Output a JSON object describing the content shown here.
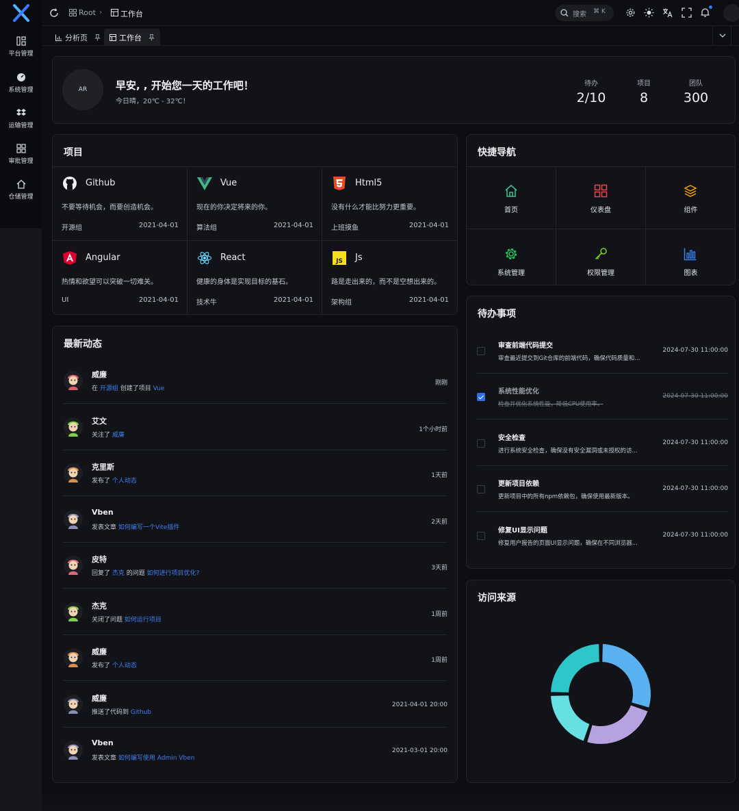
{
  "sidebar": {
    "items": [
      {
        "label": "平台管理",
        "icon": "platform-icon"
      },
      {
        "label": "系统管理",
        "icon": "dashboard-icon"
      },
      {
        "label": "运输管理",
        "icon": "dropbox-icon"
      },
      {
        "label": "审批管理",
        "icon": "grid-icon"
      },
      {
        "label": "仓储管理",
        "icon": "home-icon"
      }
    ]
  },
  "header": {
    "breadcrumb": [
      "Root",
      "工作台"
    ],
    "search_placeholder": "搜索",
    "search_shortcut": "⌘ K"
  },
  "tabs": [
    {
      "label": "分析页",
      "icon": "chart-icon",
      "active": false
    },
    {
      "label": "工作台",
      "icon": "workspace-icon",
      "active": true
    }
  ],
  "welcome": {
    "avatar_text": "AR",
    "greeting": "早安, , 开始您一天的工作吧！",
    "weather": "今日晴，20℃ - 32℃！",
    "stats": [
      {
        "label": "待办",
        "value": "2/10"
      },
      {
        "label": "项目",
        "value": "8"
      },
      {
        "label": "团队",
        "value": "300"
      }
    ]
  },
  "projects": {
    "title": "项目",
    "items": [
      {
        "name": "Github",
        "desc": "不要等待机会，而要创造机会。",
        "group": "开源组",
        "date": "2021-04-01",
        "icon": "github-icon"
      },
      {
        "name": "Vue",
        "desc": "现在的你决定将来的你。",
        "group": "算法组",
        "date": "2021-04-01",
        "icon": "vue-icon"
      },
      {
        "name": "Html5",
        "desc": "没有什么才能比努力更重要。",
        "group": "上班摸鱼",
        "date": "2021-04-01",
        "icon": "html5-icon"
      },
      {
        "name": "Angular",
        "desc": "热情和欲望可以突破一切难关。",
        "group": "UI",
        "date": "2021-04-01",
        "icon": "angular-icon"
      },
      {
        "name": "React",
        "desc": "健康的身体是实现目标的基石。",
        "group": "技术牛",
        "date": "2021-04-01",
        "icon": "react-icon"
      },
      {
        "name": "Js",
        "desc": "路是走出来的，而不是空想出来的。",
        "group": "架构组",
        "date": "2021-04-01",
        "icon": "js-icon"
      }
    ]
  },
  "quick_nav": {
    "title": "快捷导航",
    "items": [
      {
        "label": "首页",
        "icon": "home-icon",
        "color": "#3fbf8f"
      },
      {
        "label": "仪表盘",
        "icon": "dashboard-grid-icon",
        "color": "#e5484d"
      },
      {
        "label": "组件",
        "icon": "layers-icon",
        "color": "#f59e0b"
      },
      {
        "label": "系统管理",
        "icon": "gear-icon",
        "color": "#22c55e"
      },
      {
        "label": "权限管理",
        "icon": "key-icon",
        "color": "#84cc16"
      },
      {
        "label": "图表",
        "icon": "bar-chart-icon",
        "color": "#3b82f6"
      }
    ]
  },
  "activity": {
    "title": "最新动态",
    "items": [
      {
        "name": "威廉",
        "prefix": "在",
        "link1": "开源组",
        "mid": "创建了项目",
        "link2": "Vue",
        "time": "刚刚"
      },
      {
        "name": "艾文",
        "prefix": "关注了",
        "link1": "威廉",
        "mid": "",
        "link2": "",
        "time": "1个小时前"
      },
      {
        "name": "克里斯",
        "prefix": "发布了",
        "link1": "个人动态",
        "mid": "",
        "link2": "",
        "time": "1天前"
      },
      {
        "name": "Vben",
        "prefix": "发表文章",
        "link1": "如何编写一个Vite插件",
        "mid": "",
        "link2": "",
        "time": "2天前"
      },
      {
        "name": "皮特",
        "prefix": "回复了",
        "link1": "杰克",
        "mid": "的问题",
        "link2": "如何进行项目优化?",
        "time": "3天前"
      },
      {
        "name": "杰克",
        "prefix": "关闭了问题",
        "link1": "如何运行项目",
        "mid": "",
        "link2": "",
        "time": "1周前"
      },
      {
        "name": "威廉",
        "prefix": "发布了",
        "link1": "个人动态",
        "mid": "",
        "link2": "",
        "time": "1周前"
      },
      {
        "name": "威廉",
        "prefix": "推送了代码到",
        "link1": "Github",
        "mid": "",
        "link2": "",
        "time": "2021-04-01 20:00"
      },
      {
        "name": "Vben",
        "prefix": "发表文章",
        "link1": "如何编写使用 Admin Vben",
        "mid": "",
        "link2": "",
        "time": "2021-03-01 20:00"
      }
    ]
  },
  "todos": {
    "title": "待办事项",
    "items": [
      {
        "title": "审查前端代码提交",
        "desc": "审查最近提交到Git仓库的前端代码，确保代码质量和...",
        "date": "2024-07-30 11:00:00",
        "done": false
      },
      {
        "title": "系统性能优化",
        "desc": "检查并优化系统性能，降低CPU使用率。",
        "date": "2024-07-30 11:00:00",
        "done": true
      },
      {
        "title": "安全检查",
        "desc": "进行系统安全检查，确保没有安全漏洞或未授权的访...",
        "date": "2024-07-30 11:00:00",
        "done": false
      },
      {
        "title": "更新项目依赖",
        "desc": "更新项目中的所有npm依赖包，确保使用最新版本。",
        "date": "2024-07-30 11:00:00",
        "done": false
      },
      {
        "title": "修复UI显示问题",
        "desc": "修复用户报告的页面UI显示问题，确保在不同浏览器...",
        "date": "2024-07-30 11:00:00",
        "done": false
      }
    ]
  },
  "traffic": {
    "title": "访问来源",
    "chart_data": {
      "type": "pie",
      "variant": "donut",
      "values": [
        30,
        25,
        20,
        25
      ],
      "colors": [
        "#5ab1ef",
        "#b6a2de",
        "#67e0e3",
        "#2ec7c9"
      ]
    }
  }
}
